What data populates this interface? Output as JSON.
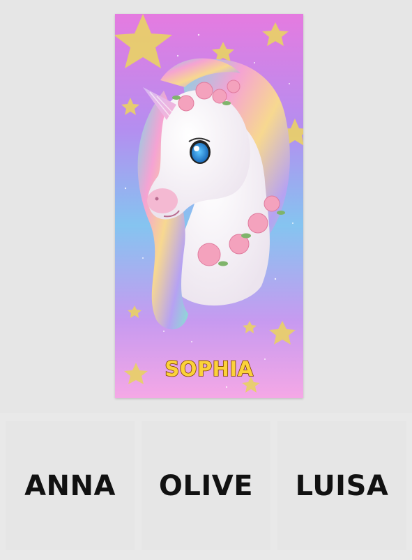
{
  "towel": {
    "name": "SOPHIA",
    "name_color": "#fbd23a",
    "background_gradient": [
      "#e57be0",
      "#b48ef0",
      "#85c4f0",
      "#f5a8e6"
    ],
    "motif": "unicode-icon"
  },
  "name_options": [
    {
      "label": "ANNA"
    },
    {
      "label": "OLIVE"
    },
    {
      "label": "LUISA"
    }
  ]
}
